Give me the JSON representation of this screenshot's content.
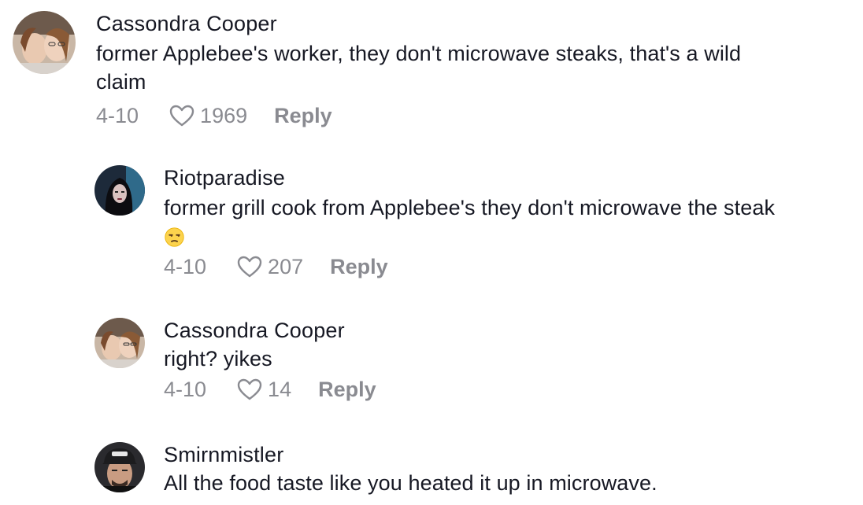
{
  "comments": [
    {
      "author": "Cassondra Cooper",
      "text": "former Applebee's worker, they don't microwave steaks, that's a wild",
      "text_line2": "claim",
      "date": "4-10",
      "likes": "1969",
      "reply_label": "Reply"
    },
    {
      "author": "Riotparadise",
      "text": "former grill cook from Applebee's they don't microwave the steak",
      "emoji": "unamused-face-emoji",
      "date": "4-10",
      "likes": "207",
      "reply_label": "Reply"
    },
    {
      "author": "Cassondra Cooper",
      "text": "right? yikes",
      "date": "4-10",
      "likes": "14",
      "reply_label": "Reply"
    },
    {
      "author": "Smirnmistler",
      "text": "All the food taste like you heated it up in microwave."
    }
  ],
  "icons": {
    "like": "heart-outline-icon"
  },
  "colors": {
    "text": "#161823",
    "meta": "#8a8b91"
  }
}
